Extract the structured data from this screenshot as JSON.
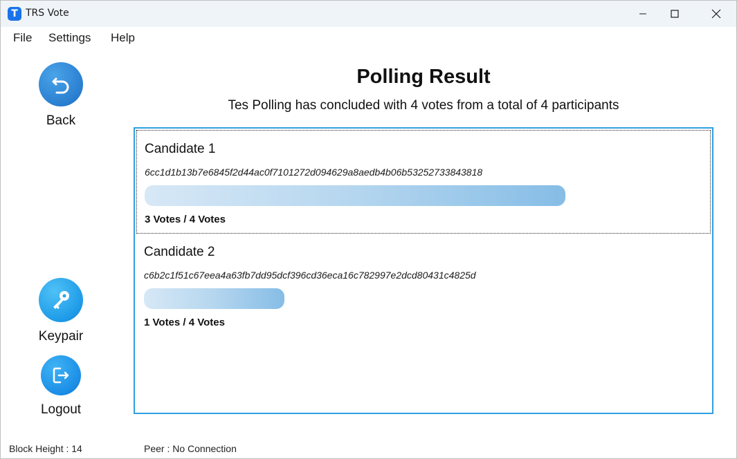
{
  "window": {
    "title": "TRS Vote",
    "app_icon_letter": "T"
  },
  "menu": {
    "items": [
      "File",
      "Settings",
      "Help"
    ]
  },
  "sidebar": {
    "back_label": "Back",
    "keypair_label": "Keypair",
    "logout_label": "Logout"
  },
  "main": {
    "title": "Polling Result",
    "subtitle": "Tes Polling has concluded with 4 votes from a total of 4 participants",
    "candidates": [
      {
        "name": "Candidate 1",
        "hash": "6cc1d1b13b7e6845f2d44ac0f7101272d094629a8aedb4b06b53252733843818",
        "votes": 3,
        "total": 4,
        "votes_label": "3 Votes / 4 Votes"
      },
      {
        "name": "Candidate 2",
        "hash": "c6b2c1f51c67eea4a63fb7dd95dcf396cd36eca16c782997e2dcd80431c4825d",
        "votes": 1,
        "total": 4,
        "votes_label": "1 Votes / 4 Votes"
      }
    ]
  },
  "status": {
    "block_height": "Block Height : 14",
    "peer": "Peer : No Connection"
  },
  "colors": {
    "accent_border": "#2f9fe0",
    "bar_start": "#d7e8f6",
    "bar_end": "#86bde6",
    "titlebar_bg": "#eff4f9"
  }
}
